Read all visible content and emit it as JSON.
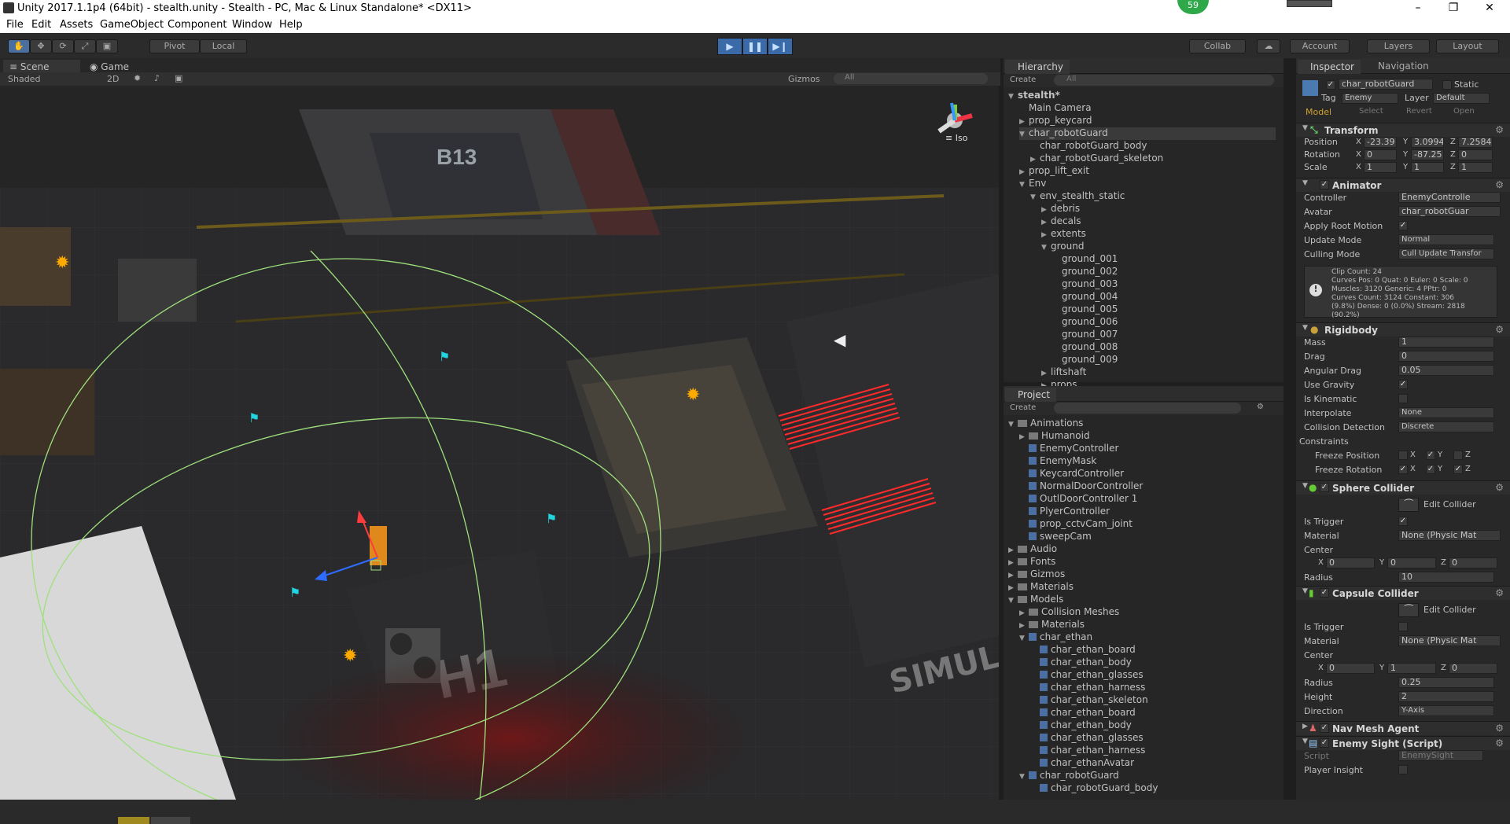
{
  "title": "Unity 2017.1.1p4 (64bit) - stealth.unity - Stealth - PC, Mac & Linux Standalone* <DX11>",
  "badge": "59",
  "window_controls": [
    "–",
    "❐",
    "✕"
  ],
  "menu": [
    "File",
    "Edit",
    "Assets",
    "GameObject",
    "Component",
    "Window",
    "Help"
  ],
  "toolbar": {
    "pivot": "Pivot",
    "local": "Local",
    "collab": "Collab",
    "account": "Account",
    "layers": "Layers",
    "layout": "Layout"
  },
  "scene_tabs": {
    "scene": "Scene",
    "game": "Game"
  },
  "scene_bar": {
    "shaded": "Shaded",
    "two_d": "2D",
    "gizmos": "Gizmos",
    "search": "All"
  },
  "scene": {
    "iso": "Iso",
    "truck_label": "B13",
    "pad_label": "H1",
    "wall_text": "SIMUL"
  },
  "hierarchy": {
    "tab": "Hierarchy",
    "create": "Create",
    "search": "All",
    "items": [
      {
        "text": "stealth*",
        "indent": 0,
        "arrow": "▼"
      },
      {
        "text": "Main Camera",
        "indent": 1,
        "arrow": ""
      },
      {
        "text": "prop_keycard",
        "indent": 1,
        "arrow": "▶"
      },
      {
        "text": "char_robotGuard",
        "indent": 1,
        "arrow": "▼"
      },
      {
        "text": "char_robotGuard_body",
        "indent": 2,
        "arrow": ""
      },
      {
        "text": "char_robotGuard_skeleton",
        "indent": 2,
        "arrow": "▶"
      },
      {
        "text": "prop_lift_exit",
        "indent": 1,
        "arrow": "▶"
      },
      {
        "text": "Env",
        "indent": 1,
        "arrow": "▼"
      },
      {
        "text": "env_stealth_static",
        "indent": 2,
        "arrow": "▼"
      },
      {
        "text": "debris",
        "indent": 3,
        "arrow": "▶"
      },
      {
        "text": "decals",
        "indent": 3,
        "arrow": "▶"
      },
      {
        "text": "extents",
        "indent": 3,
        "arrow": "▶"
      },
      {
        "text": "ground",
        "indent": 3,
        "arrow": "▼"
      },
      {
        "text": "ground_001",
        "indent": 4,
        "arrow": ""
      },
      {
        "text": "ground_002",
        "indent": 4,
        "arrow": ""
      },
      {
        "text": "ground_003",
        "indent": 4,
        "arrow": ""
      },
      {
        "text": "ground_004",
        "indent": 4,
        "arrow": ""
      },
      {
        "text": "ground_005",
        "indent": 4,
        "arrow": ""
      },
      {
        "text": "ground_006",
        "indent": 4,
        "arrow": ""
      },
      {
        "text": "ground_007",
        "indent": 4,
        "arrow": ""
      },
      {
        "text": "ground_008",
        "indent": 4,
        "arrow": ""
      },
      {
        "text": "ground_009",
        "indent": 4,
        "arrow": ""
      },
      {
        "text": "liftshaft",
        "indent": 3,
        "arrow": "▶"
      },
      {
        "text": "props",
        "indent": 3,
        "arrow": "▶"
      }
    ]
  },
  "project": {
    "tab": "Project",
    "create": "Create",
    "items": [
      {
        "text": "Animations",
        "indent": 0,
        "arrow": "▼",
        "kind": "folder"
      },
      {
        "text": "Humanoid",
        "indent": 1,
        "arrow": "▶",
        "kind": "folder"
      },
      {
        "text": "EnemyController",
        "indent": 1,
        "arrow": "",
        "kind": "asset"
      },
      {
        "text": "EnemyMask",
        "indent": 1,
        "arrow": "",
        "kind": "asset"
      },
      {
        "text": "KeycardController",
        "indent": 1,
        "arrow": "",
        "kind": "asset"
      },
      {
        "text": "NormalDoorController",
        "indent": 1,
        "arrow": "",
        "kind": "asset"
      },
      {
        "text": "OutlDoorController 1",
        "indent": 1,
        "arrow": "",
        "kind": "asset"
      },
      {
        "text": "PlyerController",
        "indent": 1,
        "arrow": "",
        "kind": "asset"
      },
      {
        "text": "prop_cctvCam_joint",
        "indent": 1,
        "arrow": "",
        "kind": "asset"
      },
      {
        "text": "sweepCam",
        "indent": 1,
        "arrow": "",
        "kind": "asset"
      },
      {
        "text": "Audio",
        "indent": 0,
        "arrow": "▶",
        "kind": "folder"
      },
      {
        "text": "Fonts",
        "indent": 0,
        "arrow": "▶",
        "kind": "folder"
      },
      {
        "text": "Gizmos",
        "indent": 0,
        "arrow": "▶",
        "kind": "folder"
      },
      {
        "text": "Materials",
        "indent": 0,
        "arrow": "▶",
        "kind": "folder"
      },
      {
        "text": "Models",
        "indent": 0,
        "arrow": "▼",
        "kind": "folder"
      },
      {
        "text": "Collision Meshes",
        "indent": 1,
        "arrow": "▶",
        "kind": "folder"
      },
      {
        "text": "Materials",
        "indent": 1,
        "arrow": "▶",
        "kind": "folder"
      },
      {
        "text": "char_ethan",
        "indent": 1,
        "arrow": "▼",
        "kind": "asset"
      },
      {
        "text": "char_ethan_board",
        "indent": 2,
        "arrow": "",
        "kind": "asset"
      },
      {
        "text": "char_ethan_body",
        "indent": 2,
        "arrow": "",
        "kind": "asset"
      },
      {
        "text": "char_ethan_glasses",
        "indent": 2,
        "arrow": "",
        "kind": "asset"
      },
      {
        "text": "char_ethan_harness",
        "indent": 2,
        "arrow": "",
        "kind": "asset"
      },
      {
        "text": "char_ethan_skeleton",
        "indent": 2,
        "arrow": "",
        "kind": "asset"
      },
      {
        "text": "char_ethan_board",
        "indent": 2,
        "arrow": "",
        "kind": "asset"
      },
      {
        "text": "char_ethan_body",
        "indent": 2,
        "arrow": "",
        "kind": "asset"
      },
      {
        "text": "char_ethan_glasses",
        "indent": 2,
        "arrow": "",
        "kind": "asset"
      },
      {
        "text": "char_ethan_harness",
        "indent": 2,
        "arrow": "",
        "kind": "asset"
      },
      {
        "text": "char_ethanAvatar",
        "indent": 2,
        "arrow": "",
        "kind": "asset"
      },
      {
        "text": "char_robotGuard",
        "indent": 1,
        "arrow": "▼",
        "kind": "asset"
      },
      {
        "text": "char_robotGuard_body",
        "indent": 2,
        "arrow": "",
        "kind": "asset"
      }
    ]
  },
  "inspector": {
    "tab": "Inspector",
    "nav_tab": "Navigation",
    "object_name": "char_robotGuard",
    "static": "Static",
    "tag_label": "Tag",
    "tag": "Enemy",
    "layer_label": "Layer",
    "layer": "Default",
    "model": "Model",
    "select": "Select",
    "revert": "Revert",
    "open": "Open",
    "transform": {
      "title": "Transform",
      "position_label": "Position",
      "rotation_label": "Rotation",
      "scale_label": "Scale",
      "px": "-23.39",
      "py": "3.0994",
      "pz": "7.2584",
      "rx": "0",
      "ry": "-87.25",
      "rz": "0",
      "sx": "1",
      "sy": "1",
      "sz": "1"
    },
    "animator": {
      "title": "Animator",
      "controller_label": "Controller",
      "controller": "EnemyControlle",
      "avatar_label": "Avatar",
      "avatar": "char_robotGuar",
      "root_motion_label": "Apply Root Motion",
      "update_mode_label": "Update Mode",
      "update_mode": "Normal",
      "culling_label": "Culling Mode",
      "culling": "Cull Update Transfor",
      "info": "Clip Count: 24\nCurves Pos: 0 Quat: 0 Euler: 0 Scale: 0\nMuscles: 3120 Generic: 4 PPtr: 0\nCurves Count: 3124 Constant: 306\n(9.8%) Dense: 0 (0.0%) Stream: 2818\n(90.2%)"
    },
    "rigidbody": {
      "title": "Rigidbody",
      "mass_label": "Mass",
      "mass": "1",
      "drag_label": "Drag",
      "drag": "0",
      "angular_label": "Angular Drag",
      "angular": "0.05",
      "gravity_label": "Use Gravity",
      "kinematic_label": "Is Kinematic",
      "interp_label": "Interpolate",
      "interp": "None",
      "collision_label": "Collision Detection",
      "collision": "Discrete",
      "constraints_label": "Constraints",
      "freeze_pos_label": "Freeze Position",
      "freeze_rot_label": "Freeze Rotation"
    },
    "sphere": {
      "title": "Sphere Collider",
      "edit": "Edit Collider",
      "trigger_label": "Is Trigger",
      "material_label": "Material",
      "material": "None (Physic Mat",
      "center_label": "Center",
      "cx": "0",
      "cy": "0",
      "cz": "0",
      "radius_label": "Radius",
      "radius": "10"
    },
    "capsule": {
      "title": "Capsule Collider",
      "edit": "Edit Collider",
      "trigger_label": "Is Trigger",
      "material_label": "Material",
      "material": "None (Physic Mat",
      "center_label": "Center",
      "cx": "0",
      "cy": "1",
      "cz": "0",
      "radius_label": "Radius",
      "radius": "0.25",
      "height_label": "Height",
      "height": "2",
      "direction_label": "Direction",
      "direction": "Y-Axis"
    },
    "navmesh": {
      "title": "Nav Mesh Agent"
    },
    "enemysight": {
      "title": "Enemy Sight (Script)",
      "script_label": "Script",
      "script": "EnemySight",
      "insight_label": "Player Insight"
    }
  },
  "colors": {
    "accent": "#3a6ba8",
    "bg": "#262626",
    "sight_ring": "#a7e08a",
    "laser": "#ff2020"
  }
}
